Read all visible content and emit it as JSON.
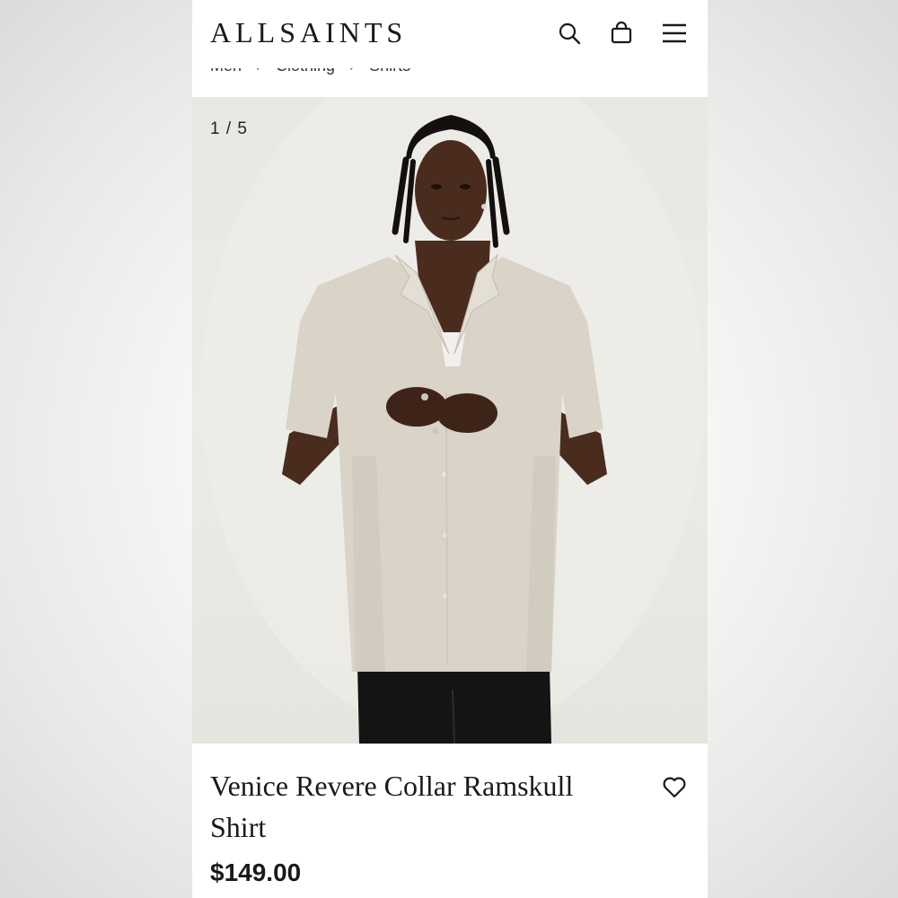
{
  "header": {
    "logo": "ALLSAINTS",
    "icons": [
      "search-icon",
      "bag-icon",
      "menu-icon"
    ]
  },
  "breadcrumb": {
    "items": [
      "Men",
      "Clothing",
      "Shirts"
    ],
    "separator": "›"
  },
  "gallery": {
    "counter": "1 / 5"
  },
  "product": {
    "title": "Venice Revere Collar Ramskull Shirt",
    "price": "$149.00"
  },
  "colors": {
    "text": "#1a1a1a",
    "gallery_bg": "#e9e8e4",
    "shirt": "#d9d3c8"
  }
}
